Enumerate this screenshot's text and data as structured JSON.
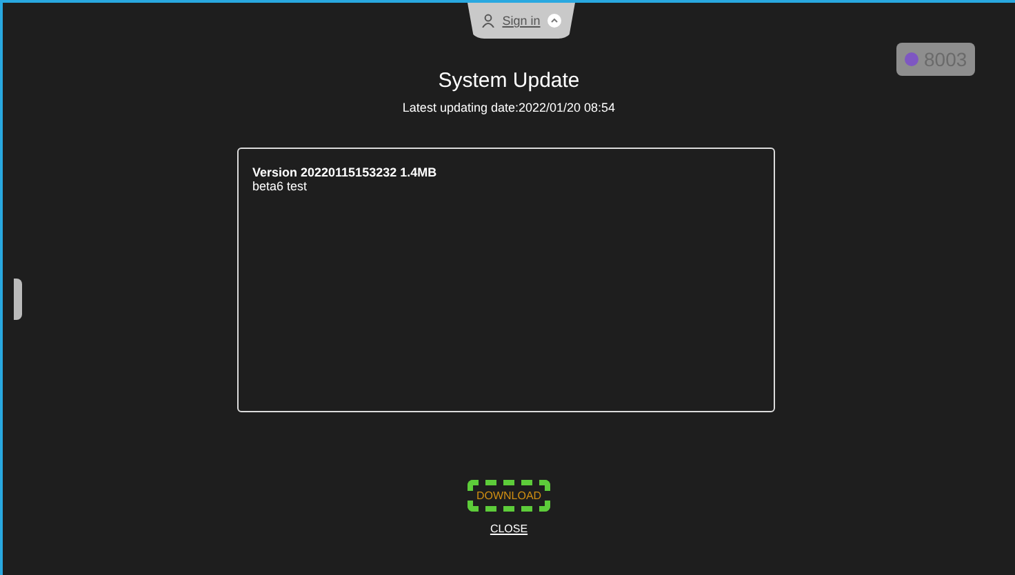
{
  "account": {
    "label": "Sign in"
  },
  "badge": {
    "number": "8003",
    "color": "#7e57c2"
  },
  "title": "System Update",
  "latest_date": "Latest updating date:2022/01/20 08:54",
  "release_notes": {
    "version": "Version 20220115153232 1.4MB",
    "note": "beta6 test"
  },
  "buttons": [
    {
      "label": "DOWNLOAD",
      "kind": "primary"
    },
    {
      "label": "CLOSE",
      "kind": "link"
    }
  ]
}
